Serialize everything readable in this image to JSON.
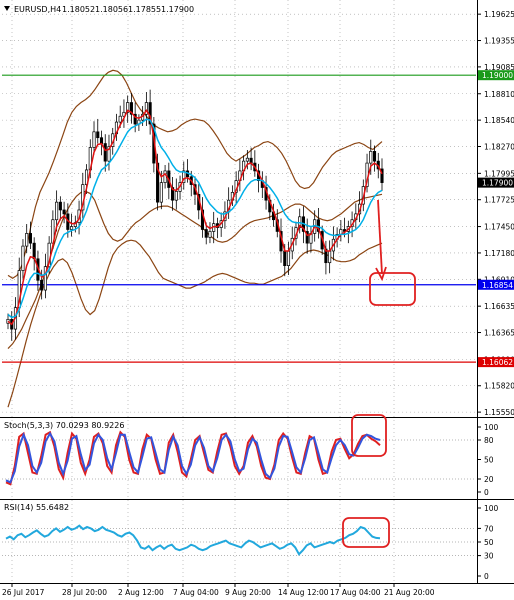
{
  "header": {
    "symbol": "EURUSD,H4",
    "open": "1.18052",
    "high": "1.18056",
    "low": "1.17855",
    "close": "1.17900"
  },
  "colors": {
    "bull": "#000000",
    "bear": "#000000",
    "ma_fast": "#e01010",
    "ma_slow": "#00b0e8",
    "bands": "#8b4513",
    "level_top": "#1a9a1a",
    "level_mid": "#0000ee",
    "level_low": "#dd0000",
    "annotation": "#e02020",
    "stoch_main": "#e02020",
    "stoch_signal": "#3355dd",
    "rsi": "#22a8dd",
    "grid": "#9e9e9e"
  },
  "chart_data": [
    {
      "type": "candlestick",
      "title": "EURUSD,H4",
      "ylim": [
        1.155,
        1.1977
      ],
      "y_ticks": [
        "1.19625",
        "1.19355",
        "1.19085",
        "1.18810",
        "1.18540",
        "1.18270",
        "1.17995",
        "1.17725",
        "1.17450",
        "1.17180",
        "1.16910",
        "1.16635",
        "1.16365",
        "1.16090",
        "1.15820",
        "1.15550"
      ],
      "x_ticks": [
        "26 Jul 2017",
        "28 Jul 20:00",
        "2 Aug 12:00",
        "7 Aug 04:00",
        "9 Aug 20:00",
        "14 Aug 12:00",
        "17 Aug 04:00",
        "21 Aug 20:00"
      ],
      "horizontal_levels": [
        {
          "value": 1.19,
          "label": "1.19000",
          "color": "#1a9a1a"
        },
        {
          "value": 1.16854,
          "label": "1.16854",
          "color": "#0000ee"
        },
        {
          "value": 1.16062,
          "label": "1.16062",
          "color": "#dd0000"
        }
      ],
      "current_price": {
        "value": 1.179,
        "label": "1.17900"
      },
      "closes": [
        1.165,
        1.164,
        1.1662,
        1.17,
        1.1725,
        1.1738,
        1.1728,
        1.1712,
        1.169,
        1.168,
        1.1704,
        1.1728,
        1.1752,
        1.177,
        1.1762,
        1.1758,
        1.1742,
        1.1745,
        1.1749,
        1.1762,
        1.1788,
        1.1803,
        1.1826,
        1.1842,
        1.1836,
        1.183,
        1.1812,
        1.1827,
        1.184,
        1.1852,
        1.1858,
        1.1862,
        1.1872,
        1.186,
        1.185,
        1.1854,
        1.186,
        1.1872,
        1.185,
        1.181,
        1.177,
        1.179,
        1.1802,
        1.1785,
        1.1772,
        1.1781,
        1.179,
        1.1802,
        1.1796,
        1.1788,
        1.1778,
        1.1762,
        1.1742,
        1.1734,
        1.174,
        1.1748,
        1.1744,
        1.1751,
        1.176,
        1.1772,
        1.178,
        1.1792,
        1.1802,
        1.1812,
        1.1815,
        1.181,
        1.1802,
        1.1792,
        1.1785,
        1.1772,
        1.176,
        1.1752,
        1.174,
        1.172,
        1.1705,
        1.172,
        1.1733,
        1.1744,
        1.1755,
        1.174,
        1.1728,
        1.1738,
        1.1752,
        1.174,
        1.1722,
        1.1708,
        1.172,
        1.1732,
        1.1737,
        1.1742,
        1.174,
        1.1745,
        1.1752,
        1.1758,
        1.1768,
        1.1786,
        1.181,
        1.1822,
        1.1812,
        1.1804,
        1.179
      ],
      "series": [
        {
          "name": "",
          "color": "#e01010",
          "values": [
            1.1648,
            1.1645,
            1.1652,
            1.1668,
            1.1688,
            1.1705,
            1.1714,
            1.1713,
            1.1703,
            1.1693,
            1.1696,
            1.1708,
            1.1726,
            1.1745,
            1.1753,
            1.1756,
            1.1751,
            1.1748,
            1.1748,
            1.1753,
            1.1768,
            1.1784,
            1.1803,
            1.1821,
            1.1829,
            1.183,
            1.1823,
            1.1824,
            1.1831,
            1.1841,
            1.1849,
            1.1856,
            1.1864,
            1.1862,
            1.1857,
            1.1856,
            1.1858,
            1.1864,
            1.1858,
            1.1836,
            1.1804,
            1.1796,
            1.1799,
            1.1793,
            1.1783,
            1.1782,
            1.1786,
            1.1794,
            1.1795,
            1.1792,
            1.1785,
            1.1774,
            1.1759,
            1.1746,
            1.1743,
            1.1745,
            1.1745,
            1.1748,
            1.1754,
            1.1763,
            1.1772,
            1.1782,
            1.1792,
            1.1802,
            1.1809,
            1.181,
            1.1806,
            1.1799,
            1.1792,
            1.1782,
            1.1771,
            1.1761,
            1.175,
            1.1735,
            1.172,
            1.172,
            1.1727,
            1.1736,
            1.1746,
            1.1743,
            1.1736,
            1.1737,
            1.1745,
            1.1743,
            1.1733,
            1.172,
            1.172,
            1.1726,
            1.1732,
            1.1737,
            1.1739,
            1.1742,
            1.1747,
            1.1753,
            1.1761,
            1.1774,
            1.1792,
            1.1807,
            1.181,
            1.1807,
            1.1799
          ]
        },
        {
          "name": "",
          "color": "#00b0e8",
          "values": [
            1.1655,
            1.1652,
            1.1653,
            1.166,
            1.1671,
            1.1683,
            1.1692,
            1.1697,
            1.1697,
            1.1695,
            1.1696,
            1.1701,
            1.171,
            1.1721,
            1.173,
            1.1737,
            1.1739,
            1.1741,
            1.1742,
            1.1745,
            1.1752,
            1.1761,
            1.1773,
            1.1785,
            1.1795,
            1.1803,
            1.1806,
            1.181,
            1.1815,
            1.1821,
            1.1828,
            1.1835,
            1.1842,
            1.1846,
            1.1848,
            1.185,
            1.1852,
            1.1855,
            1.1854,
            1.1846,
            1.1834,
            1.1826,
            1.1821,
            1.1815,
            1.1808,
            1.1803,
            1.1801,
            1.1801,
            1.18,
            1.1798,
            1.1795,
            1.179,
            1.1782,
            1.1774,
            1.1768,
            1.1764,
            1.176,
            1.1758,
            1.1758,
            1.176,
            1.1763,
            1.1768,
            1.1774,
            1.1781,
            1.1787,
            1.1791,
            1.1793,
            1.1793,
            1.1792,
            1.1789,
            1.1785,
            1.178,
            1.1774,
            1.1766,
            1.1758,
            1.1753,
            1.175,
            1.1749,
            1.1749,
            1.1748,
            1.1746,
            1.1745,
            1.1746,
            1.1745,
            1.1743,
            1.1739,
            1.1737,
            1.1736,
            1.1736,
            1.1737,
            1.1737,
            1.1738,
            1.174,
            1.1742,
            1.1746,
            1.1752,
            1.1761,
            1.177,
            1.1776,
            1.178,
            1.1782
          ]
        },
        {
          "name": "",
          "color": "#8b4513",
          "values": [
            1.1695,
            1.1692,
            1.1695,
            1.1705,
            1.1722,
            1.1745,
            1.1765,
            1.178,
            1.179,
            1.18,
            1.1812,
            1.1825,
            1.1838,
            1.1852,
            1.1862,
            1.1868,
            1.1872,
            1.1875,
            1.1879,
            1.1885,
            1.1892,
            1.1899,
            1.1903,
            1.1905,
            1.1904,
            1.19,
            1.1892,
            1.1882,
            1.1872,
            1.1865,
            1.186,
            1.1854,
            1.1849,
            1.1846,
            1.1844,
            1.1842,
            1.1843,
            1.1845,
            1.1849,
            1.1852,
            1.1854,
            1.1855,
            1.1854,
            1.1853,
            1.1849,
            1.1843,
            1.1836,
            1.1828,
            1.182,
            1.1815,
            1.1812,
            1.1815,
            1.1818,
            1.1822,
            1.1826,
            1.1828,
            1.1831,
            1.1832,
            1.183,
            1.1826,
            1.182,
            1.1812,
            1.1802,
            1.1792,
            1.1786,
            1.1784,
            1.1785,
            1.179,
            1.1798,
            1.1806,
            1.1812,
            1.1818,
            1.1822,
            1.1824,
            1.1826,
            1.1828,
            1.183,
            1.1831,
            1.1829,
            1.1826,
            1.1824,
            1.1828,
            1.1832
          ]
        },
        {
          "name": "",
          "color": "#8b4513",
          "values": [
            1.162,
            1.1625,
            1.1632,
            1.164,
            1.165,
            1.166,
            1.167,
            1.1682,
            1.1695,
            1.171,
            1.1725,
            1.174,
            1.1752,
            1.1762,
            1.177,
            1.1776,
            1.178,
            1.1781,
            1.1779,
            1.1772,
            1.176,
            1.1748,
            1.1738,
            1.1732,
            1.173,
            1.1732,
            1.1738,
            1.1744,
            1.1749,
            1.1752,
            1.1756,
            1.176,
            1.1763,
            1.1765,
            1.1766,
            1.1766,
            1.1764,
            1.1761,
            1.1758,
            1.1755,
            1.1752,
            1.1749,
            1.1746,
            1.1742,
            1.1737,
            1.1733,
            1.173,
            1.1729,
            1.173,
            1.1733,
            1.1737,
            1.1742,
            1.1746,
            1.1749,
            1.1751,
            1.1752,
            1.1753,
            1.1754,
            1.1756,
            1.1758,
            1.176,
            1.1763,
            1.1766,
            1.1768,
            1.1768,
            1.1766,
            1.1762,
            1.1758,
            1.1754,
            1.1752,
            1.1751,
            1.1752,
            1.1755,
            1.1758,
            1.1762,
            1.1766,
            1.177,
            1.1772,
            1.1774,
            1.1775,
            1.1776,
            1.1777,
            1.1778
          ]
        },
        {
          "name": "",
          "color": "#8b4513",
          "values": [
            1.156,
            1.1575,
            1.1592,
            1.161,
            1.1628,
            1.1645,
            1.166,
            1.1674,
            1.1686,
            1.1696,
            1.1704,
            1.171,
            1.1712,
            1.1708,
            1.1698,
            1.1685,
            1.1671,
            1.166,
            1.1655,
            1.1659,
            1.1671,
            1.1687,
            1.1703,
            1.1716,
            1.1723,
            1.1727,
            1.173,
            1.1731,
            1.173,
            1.1726,
            1.172,
            1.1714,
            1.1706,
            1.1698,
            1.1692,
            1.169,
            1.1688,
            1.1686,
            1.1684,
            1.1682,
            1.1682,
            1.1684,
            1.1686,
            1.1688,
            1.1691,
            1.1694,
            1.1696,
            1.1697,
            1.1696,
            1.1694,
            1.1692,
            1.169,
            1.1688,
            1.1687,
            1.1687,
            1.1686,
            1.1686,
            1.1688,
            1.169,
            1.1692,
            1.1694,
            1.1698,
            1.1702,
            1.1708,
            1.1714,
            1.1718,
            1.172,
            1.1721,
            1.172,
            1.1718,
            1.1716,
            1.1713,
            1.171,
            1.1709,
            1.1709,
            1.171,
            1.1712,
            1.1716,
            1.1719,
            1.1722,
            1.1724,
            1.1726,
            1.1728
          ]
        }
      ]
    },
    {
      "type": "line",
      "title": "Stoch(5,3,3) 70.0293 80.9226",
      "ylim": [
        0,
        100
      ],
      "y_ticks": [
        "100",
        "80",
        "50",
        "20",
        "0"
      ],
      "levels": [
        80,
        20
      ],
      "series": [
        {
          "name": "",
          "color": "#e02020",
          "values": [
            15,
            12,
            40,
            85,
            90,
            60,
            30,
            28,
            55,
            88,
            92,
            70,
            35,
            22,
            60,
            90,
            82,
            45,
            28,
            50,
            85,
            90,
            75,
            40,
            30,
            72,
            92,
            85,
            50,
            30,
            28,
            66,
            88,
            82,
            50,
            28,
            30,
            76,
            88,
            62,
            30,
            24,
            50,
            80,
            86,
            60,
            34,
            30,
            62,
            88,
            90,
            70,
            40,
            28,
            40,
            76,
            86,
            70,
            40,
            22,
            20,
            42,
            80,
            90,
            82,
            54,
            30,
            28,
            60,
            86,
            82,
            50,
            28,
            30,
            62,
            80,
            82,
            66,
            52,
            58,
            74,
            86,
            88,
            82,
            78,
            72
          ]
        },
        {
          "name": "",
          "color": "#3355dd",
          "values": [
            18,
            15,
            32,
            70,
            88,
            72,
            40,
            30,
            45,
            78,
            90,
            78,
            45,
            28,
            48,
            82,
            86,
            58,
            34,
            42,
            75,
            88,
            80,
            52,
            35,
            60,
            88,
            88,
            62,
            38,
            30,
            55,
            82,
            84,
            60,
            35,
            30,
            65,
            85,
            72,
            40,
            28,
            42,
            72,
            84,
            68,
            40,
            32,
            52,
            80,
            88,
            78,
            50,
            32,
            36,
            66,
            82,
            76,
            50,
            28,
            22,
            36,
            70,
            86,
            85,
            62,
            38,
            30,
            52,
            80,
            84,
            60,
            35,
            30,
            52,
            72,
            80,
            72,
            58,
            56,
            68,
            82,
            88,
            86,
            82,
            80
          ]
        }
      ]
    },
    {
      "type": "line",
      "title": "RSI(14) 55.6482",
      "ylim": [
        0,
        100
      ],
      "y_ticks": [
        "100",
        "70",
        "50",
        "30",
        "0"
      ],
      "levels": [
        70,
        50,
        30
      ],
      "series": [
        {
          "name": "",
          "color": "#22a8dd",
          "values": [
            55,
            58,
            54,
            60,
            62,
            57,
            60,
            64,
            67,
            62,
            58,
            60,
            66,
            70,
            65,
            68,
            72,
            68,
            70,
            74,
            69,
            72,
            70,
            66,
            68,
            72,
            68,
            66,
            64,
            60,
            58,
            62,
            64,
            60,
            52,
            42,
            40,
            44,
            38,
            42,
            45,
            40,
            44,
            46,
            40,
            38,
            40,
            42,
            46,
            44,
            40,
            38,
            40,
            44,
            46,
            48,
            50,
            52,
            48,
            46,
            44,
            42,
            48,
            52,
            50,
            46,
            42,
            44,
            46,
            48,
            44,
            40,
            42,
            46,
            48,
            42,
            32,
            38,
            45,
            48,
            42,
            44,
            46,
            48,
            50,
            48,
            52,
            54,
            56,
            60,
            62,
            66,
            72,
            70,
            64,
            58,
            56,
            55.6
          ]
        }
      ]
    }
  ]
}
